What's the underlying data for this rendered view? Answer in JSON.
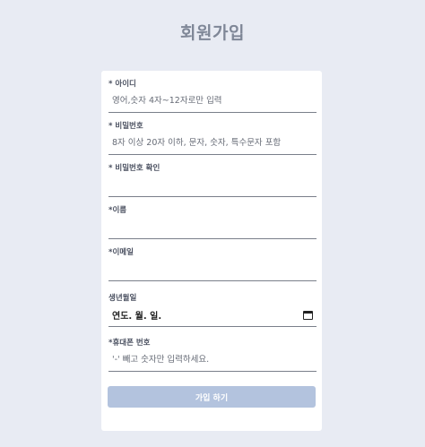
{
  "page": {
    "title": "회원가입"
  },
  "form": {
    "id": {
      "label": "* 아이디",
      "placeholder": "영어,숫자 4자~12자로만 입력"
    },
    "password": {
      "label": "* 비밀번호",
      "placeholder": "8자 이상 20자 이하, 문자, 숫자, 특수문자 포함"
    },
    "password_confirm": {
      "label": "* 비밀번호 확인",
      "placeholder": ""
    },
    "name": {
      "label": "*이름",
      "placeholder": ""
    },
    "email": {
      "label": "*이메일",
      "placeholder": ""
    },
    "birth": {
      "label": "생년월일",
      "value": "연도. 월. 일."
    },
    "phone": {
      "label": "*휴대폰 번호",
      "placeholder": "'-' 빼고 숫자만 입력하세요."
    },
    "submit_label": "가입 하기"
  },
  "icons": {
    "calendar": "calendar-icon"
  },
  "colors": {
    "background": "#e8ebf3",
    "button": "#b3c3de",
    "title": "#7f8797"
  }
}
